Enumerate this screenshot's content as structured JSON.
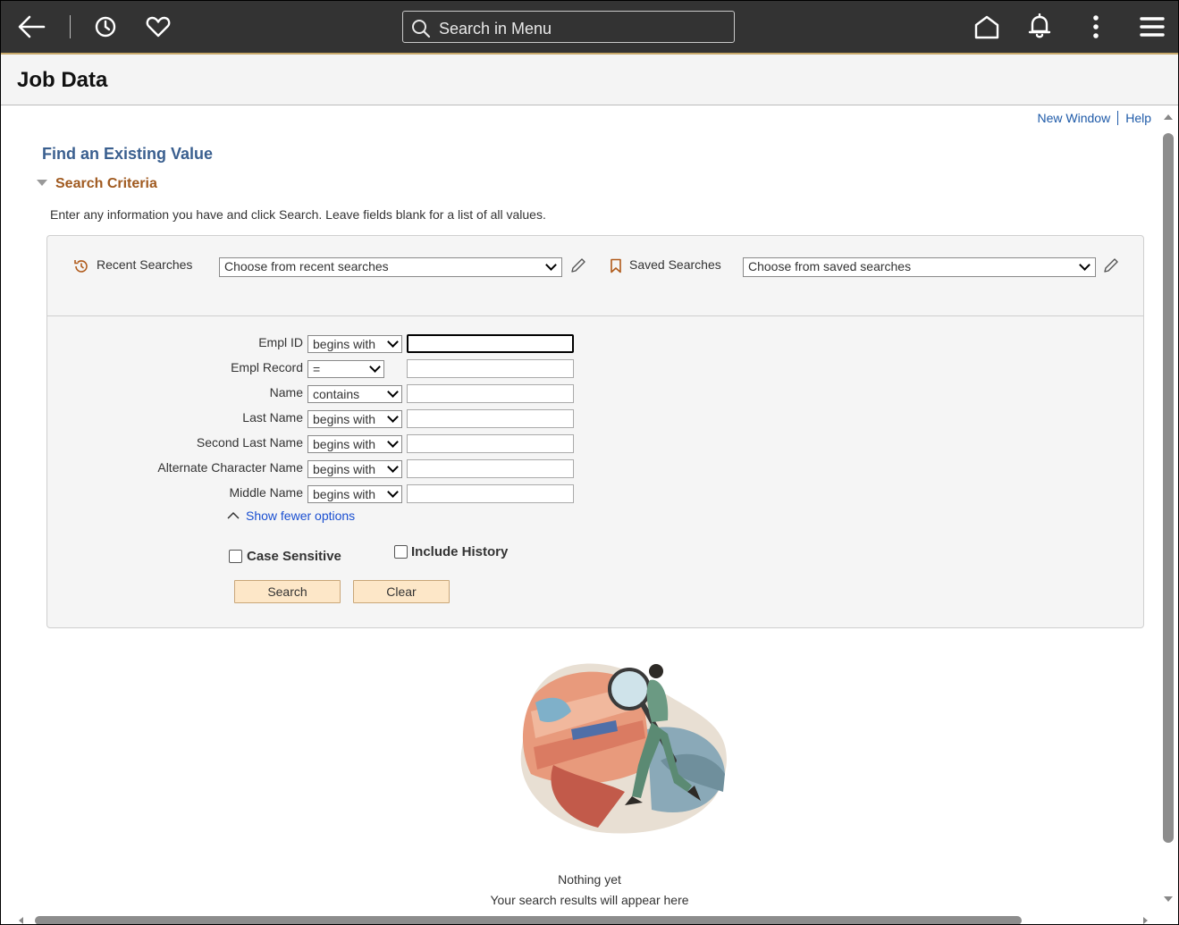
{
  "topbar": {
    "search_placeholder": "Search in Menu"
  },
  "page": {
    "title": "Job Data"
  },
  "links": {
    "new_window": "New Window",
    "help": "Help"
  },
  "find": {
    "title": "Find an Existing Value",
    "criteria_header": "Search Criteria",
    "intro": "Enter any information you have and click Search. Leave fields blank for a list of all values."
  },
  "recent": {
    "label": "Recent Searches",
    "value": "Choose from recent searches"
  },
  "saved": {
    "label": "Saved Searches",
    "value": "Choose from saved searches"
  },
  "fields": [
    {
      "label": "Empl ID",
      "operator": "begins with",
      "value": ""
    },
    {
      "label": "Empl Record",
      "operator": "=",
      "value": ""
    },
    {
      "label": "Name",
      "operator": "contains",
      "value": ""
    },
    {
      "label": "Last Name",
      "operator": "begins with",
      "value": ""
    },
    {
      "label": "Second Last Name",
      "operator": "begins with",
      "value": ""
    },
    {
      "label": "Alternate Character Name",
      "operator": "begins with",
      "value": ""
    },
    {
      "label": "Middle Name",
      "operator": "begins with",
      "value": ""
    }
  ],
  "options": {
    "show_fewer": "Show fewer options",
    "case_sensitive": "Case Sensitive",
    "case_sensitive_checked": false,
    "include_history": "Include History",
    "include_history_checked": false
  },
  "buttons": {
    "search": "Search",
    "clear": "Clear"
  },
  "results": {
    "line1": "Nothing yet",
    "line2": "Your search results will appear here"
  }
}
